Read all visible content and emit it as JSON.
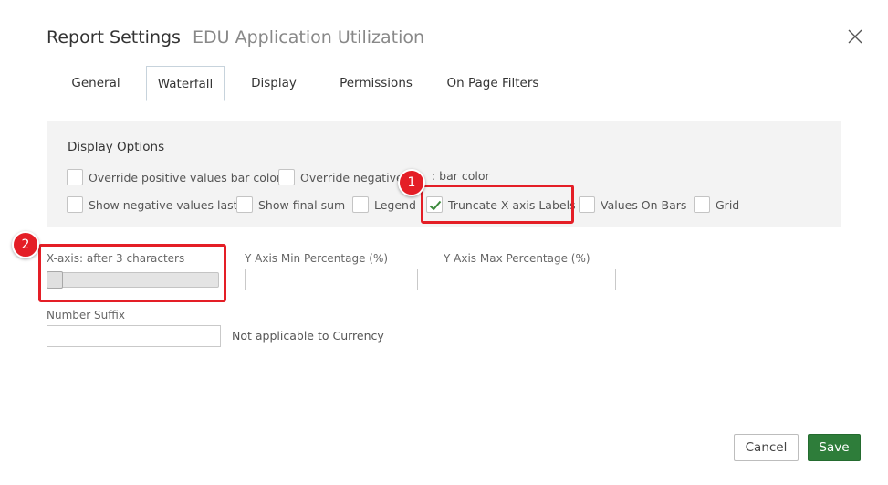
{
  "dialog": {
    "title": "Report Settings",
    "subtitle": "EDU Application Utilization"
  },
  "tabs": [
    {
      "label": "General"
    },
    {
      "label": "Waterfall",
      "active": true
    },
    {
      "label": "Display"
    },
    {
      "label": "Permissions"
    },
    {
      "label": "On Page Filters"
    }
  ],
  "display_options": {
    "heading": "Display Options",
    "items": [
      {
        "label": "Override positive values bar color",
        "checked": false
      },
      {
        "label": "Override negative",
        "checked": false
      },
      {
        "label": ": bar color"
      },
      {
        "label": "Show negative values last",
        "checked": false
      },
      {
        "label": "Show final sum",
        "checked": false
      },
      {
        "label": "Legend",
        "checked": false
      },
      {
        "label": "Truncate X-axis Labels",
        "checked": true
      },
      {
        "label": "Values On Bars",
        "checked": false
      },
      {
        "label": "Grid",
        "checked": false
      }
    ]
  },
  "annotations": [
    {
      "number": "1"
    },
    {
      "number": "2"
    }
  ],
  "fields": {
    "xaxis_label": "X-axis: after 3 characters",
    "xaxis_slider_fraction": 0.0,
    "y_min_label": "Y Axis Min Percentage (%)",
    "y_min_value": "",
    "y_max_label": "Y Axis Max Percentage (%)",
    "y_max_value": "",
    "suffix_label": "Number Suffix",
    "suffix_value": "",
    "suffix_note": "Not applicable to Currency"
  },
  "buttons": {
    "cancel": "Cancel",
    "save": "Save"
  },
  "colors": {
    "highlight": "#e41e26",
    "save": "#2e7d3a",
    "check": "#3c8a3c"
  },
  "icons": {
    "close": "close-icon",
    "check": "checkmark-icon"
  }
}
